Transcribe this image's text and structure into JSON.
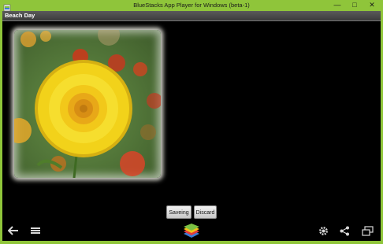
{
  "window": {
    "title": "BlueStacks App Player for Windows (beta-1)",
    "icons": {
      "minimize": "minimize-icon",
      "maximize": "maximize-icon",
      "close": "close-icon"
    }
  },
  "action_bar": {
    "title": "Beach Day"
  },
  "photo": {
    "subject": "yellow strawflower photo"
  },
  "buttons": {
    "saving_label": "Saveing",
    "discard_label": "Discard"
  },
  "navbar": {
    "icons": [
      "back-arrow-icon",
      "menu-icon",
      "bluestacks-logo-icon",
      "settings-gear-icon",
      "share-icon",
      "window-toggle-icon"
    ]
  },
  "colors": {
    "frame_green": "#8fc53a",
    "screen_bg": "#000000",
    "flower_yellow": "#f2d21a"
  }
}
